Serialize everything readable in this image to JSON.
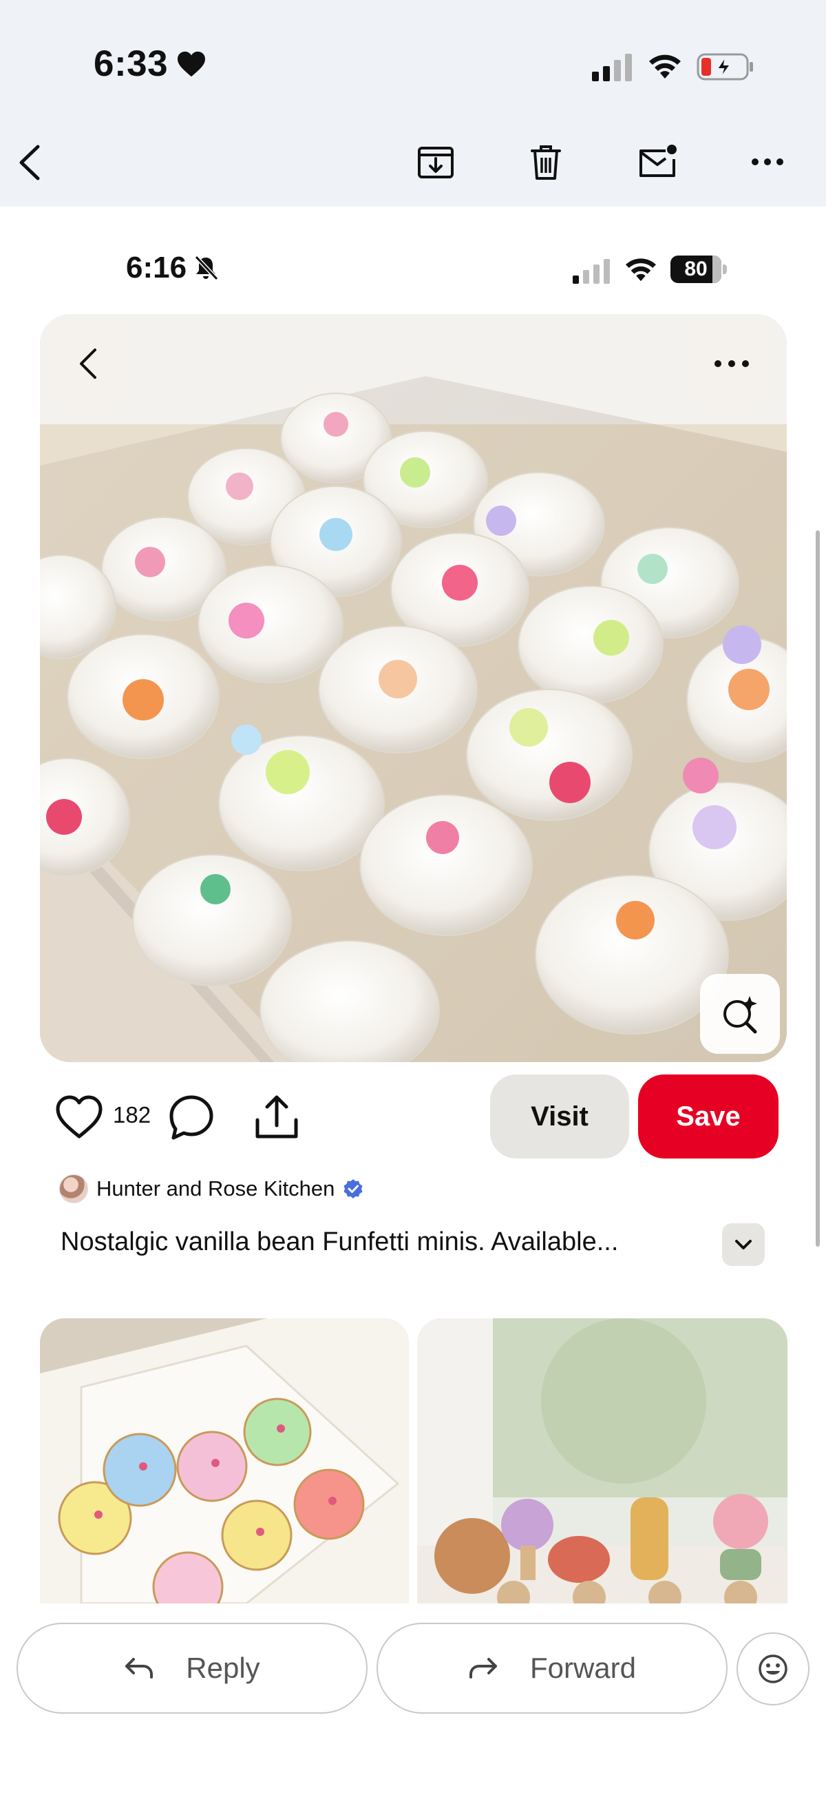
{
  "outer_status": {
    "time": "6:33",
    "heart_icon": "heart-filled-icon",
    "signal_icon": "cellular-signal-icon",
    "wifi_icon": "wifi-icon",
    "battery_icon": "battery-charging-low-icon"
  },
  "mail_toolbar": {
    "back_icon": "chevron-left-icon",
    "archive_icon": "archive-download-icon",
    "trash_icon": "trash-icon",
    "mark_unread_icon": "mail-unread-icon",
    "more_icon": "more-horizontal-icon"
  },
  "inner_status": {
    "time": "6:16",
    "battery": "80"
  },
  "pin": {
    "like_count": "182",
    "visit_label": "Visit",
    "save_label": "Save",
    "creator_name": "Hunter and Rose Kitchen",
    "description": "Nostalgic vanilla bean Funfetti minis. Available...",
    "colors": {
      "save": "#e60023",
      "visit": "#e6e5e1",
      "verified": "#4a6ee0"
    }
  },
  "bottom_bar": {
    "reply_label": "Reply",
    "forward_label": "Forward"
  }
}
